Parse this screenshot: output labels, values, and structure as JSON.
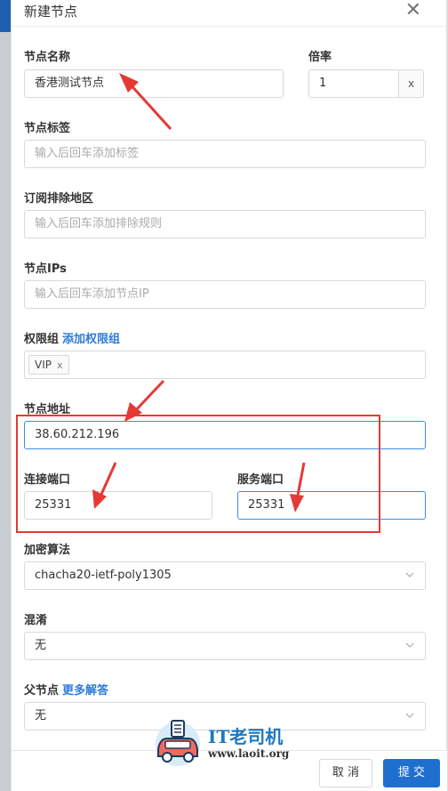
{
  "drawer": {
    "title": "新建节点",
    "close_icon": "close-icon"
  },
  "form": {
    "node_name": {
      "label": "节点名称",
      "value": "香港测试节点"
    },
    "rate": {
      "label": "倍率",
      "value": "1",
      "suffix": "x"
    },
    "node_tags": {
      "label": "节点标签",
      "placeholder": "输入后回车添加标签"
    },
    "sub_exclude_region": {
      "label": "订阅排除地区",
      "placeholder": "输入后回车添加排除规则"
    },
    "node_ips": {
      "label": "节点IPs",
      "placeholder": "输入后回车添加节点IP"
    },
    "permission_group": {
      "label": "权限组",
      "link": "添加权限组",
      "tags": [
        "VIP"
      ]
    },
    "node_address": {
      "label": "节点地址",
      "value": "38.60.212.196"
    },
    "connect_port": {
      "label": "连接端口",
      "value": "25331"
    },
    "service_port": {
      "label": "服务端口",
      "value": "25331"
    },
    "cipher": {
      "label": "加密算法",
      "value": "chacha20-ietf-poly1305"
    },
    "obfs": {
      "label": "混淆",
      "value": "无"
    },
    "parent_node": {
      "label": "父节点",
      "link": "更多解答",
      "value": "无"
    }
  },
  "footer": {
    "cancel_label": "取 消",
    "submit_label": "提 交"
  },
  "watermark": {
    "name": "IT老司机",
    "url": "www.laoit.org"
  },
  "colors": {
    "primary": "#1f6fd0",
    "annotation": "#e53935",
    "link": "#2f7bd8"
  }
}
